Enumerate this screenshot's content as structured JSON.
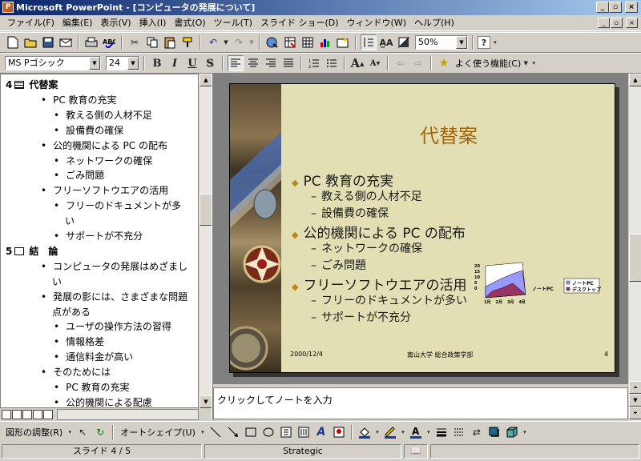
{
  "window": {
    "title": "Microsoft PowerPoint - [コンピュータの発展について]",
    "controls": [
      "_",
      "▫",
      "×"
    ]
  },
  "menu": [
    "ファイル(F)",
    "編集(E)",
    "表示(V)",
    "挿入(I)",
    "書式(O)",
    "ツール(T)",
    "スライド ショー(D)",
    "ウィンドウ(W)",
    "ヘルプ(H)"
  ],
  "toolbar_standard": {
    "zoom": "50%"
  },
  "toolbar_format": {
    "font_name": "MS Pゴシック",
    "font_size": "24",
    "bold": "B",
    "italic": "I",
    "underline": "U",
    "shadow": "S",
    "common_tasks": "よく使う機能(C)"
  },
  "outline": {
    "items": [
      {
        "level": 0,
        "num": "4",
        "text": "代替案"
      },
      {
        "level": 1,
        "text": "PC 教育の充実"
      },
      {
        "level": 2,
        "text": "教える側の人材不足"
      },
      {
        "level": 2,
        "text": "設備費の確保"
      },
      {
        "level": 1,
        "text": "公的機関による PC の配布"
      },
      {
        "level": 2,
        "text": "ネットワークの確保"
      },
      {
        "level": 2,
        "text": "ごみ問題"
      },
      {
        "level": 1,
        "text": "フリーソフトウエアの活用"
      },
      {
        "level": 2,
        "text": "フリーのドキュメントが多"
      },
      {
        "level": 2,
        "text": "い",
        "cont": true
      },
      {
        "level": 2,
        "text": "サポートが不充分"
      },
      {
        "level": 0,
        "num": "5",
        "text": "結　論"
      },
      {
        "level": 1,
        "text": "コンピュータの発展はめざまし"
      },
      {
        "level": 1,
        "text": "い",
        "cont": true
      },
      {
        "level": 1,
        "text": "発展の影には、さまざまな問題"
      },
      {
        "level": 1,
        "text": "点がある",
        "cont": true
      },
      {
        "level": 2,
        "text": "ユーザの操作方法の習得"
      },
      {
        "level": 2,
        "text": "情報格差"
      },
      {
        "level": 2,
        "text": "通信料金が高い"
      },
      {
        "level": 1,
        "text": "そのためには"
      },
      {
        "level": 2,
        "text": "PC 教育の充実"
      },
      {
        "level": 2,
        "text": "公的機関による配慮"
      }
    ]
  },
  "slide": {
    "title": "代替案",
    "bullets": [
      {
        "level": 1,
        "text": "PC 教育の充実"
      },
      {
        "level": 2,
        "text": "教える側の人材不足"
      },
      {
        "level": 2,
        "text": "設備費の確保"
      },
      {
        "level": 1,
        "text": "公的機関による PC の配布"
      },
      {
        "level": 2,
        "text": "ネットワークの確保"
      },
      {
        "level": 2,
        "text": "ごみ問題"
      },
      {
        "level": 1,
        "text": "フリーソフトウエアの活用"
      },
      {
        "level": 2,
        "text": "フリーのドキュメントが多い"
      },
      {
        "level": 2,
        "text": "サポートが不充分"
      }
    ],
    "footer_date": "2000/12/4",
    "footer_text": "南山大学 総合政策学部",
    "page_number": "4",
    "chart": {
      "y_ticks": [
        "20",
        "15",
        "10",
        "5",
        "0"
      ],
      "x_ticks": [
        "1月",
        "2月",
        "3月",
        "4月"
      ],
      "series_label": "ノートPC",
      "legend": [
        "ノートPC",
        "デスクトップ"
      ]
    }
  },
  "notes": {
    "placeholder": "クリックしてノートを入力"
  },
  "drawing_toolbar": {
    "draw_menu": "図形の調整(R)",
    "autoshapes": "オートシェイプ(U)"
  },
  "status": {
    "slide_position": "スライド 4 / 5",
    "design": "Strategic"
  },
  "colors": {
    "title_bar": "#0a246a",
    "slide_bg": "#e3dfb4",
    "slide_title": "#a0660f",
    "bullet": "#b8860b"
  }
}
